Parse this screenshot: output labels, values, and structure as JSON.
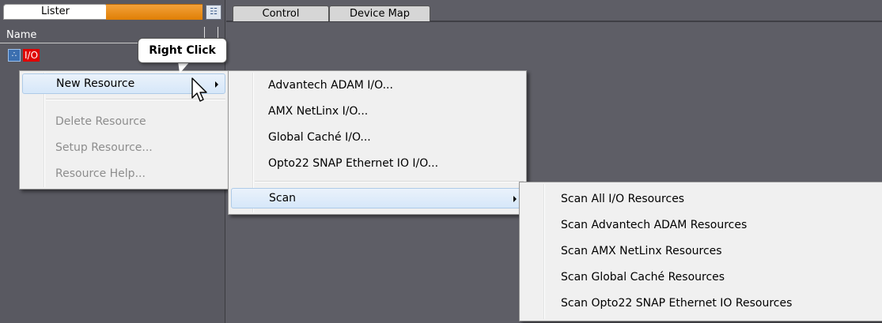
{
  "left_panel": {
    "tab_label": "Lister",
    "column_header": "Name",
    "root_item": "I/O"
  },
  "right_panel": {
    "tabs": [
      "Control",
      "Device Map"
    ]
  },
  "callout": "Right Click",
  "context_menu": {
    "items": [
      {
        "label": "New Resource",
        "state": "highlighted",
        "submenu": true
      },
      {
        "label": "Delete Resource",
        "state": "disabled"
      },
      {
        "label": "Setup Resource...",
        "state": "disabled"
      },
      {
        "label": "Resource Help...",
        "state": "disabled"
      }
    ]
  },
  "new_resource_submenu": {
    "items": [
      {
        "label": "Advantech ADAM I/O..."
      },
      {
        "label": "AMX NetLinx I/O..."
      },
      {
        "label": "Global Caché I/O..."
      },
      {
        "label": "Opto22 SNAP Ethernet IO I/O..."
      },
      {
        "label": "Scan",
        "state": "highlighted",
        "submenu": true
      }
    ]
  },
  "scan_submenu": {
    "items": [
      {
        "label": "Scan All I/O Resources"
      },
      {
        "label": "Scan Advantech ADAM Resources"
      },
      {
        "label": "Scan AMX NetLinx Resources"
      },
      {
        "label": "Scan Global Caché Resources"
      },
      {
        "label": "Scan Opto22 SNAP Ethernet IO Resources"
      }
    ]
  }
}
